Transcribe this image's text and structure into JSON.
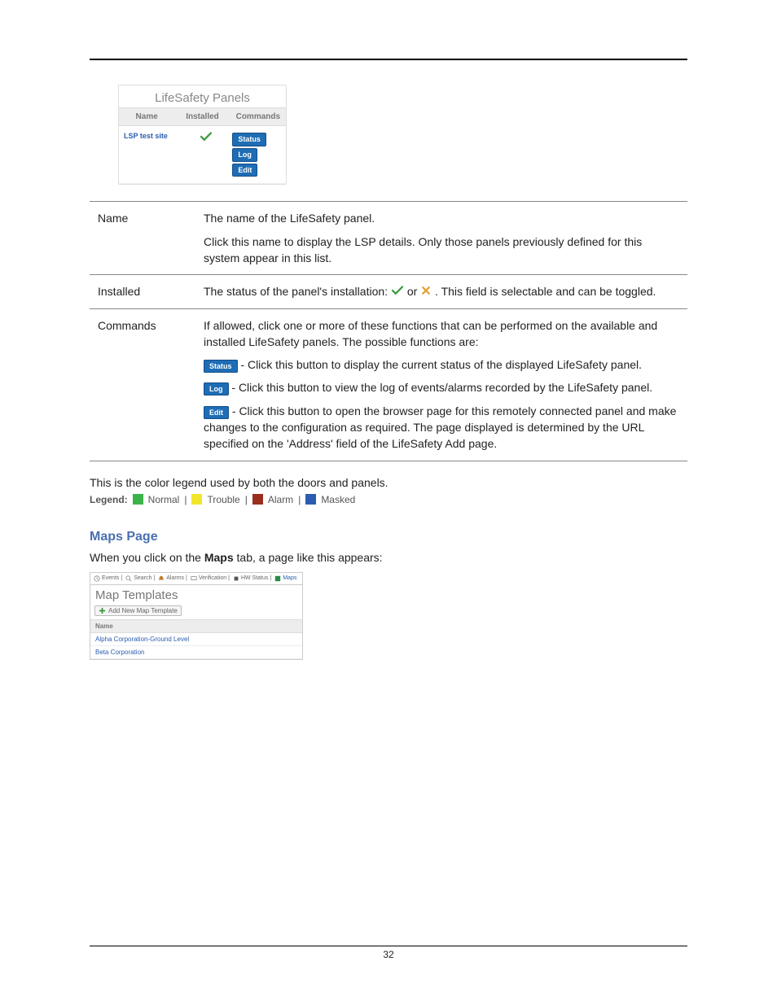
{
  "lsp": {
    "title": "LifeSafety Panels",
    "cols": [
      "Name",
      "Installed",
      "Commands"
    ],
    "row_name": "LSP test site",
    "btns": {
      "status": "Status",
      "log": "Log",
      "edit": "Edit"
    }
  },
  "desc": {
    "name_k": "Name",
    "name_v1": "The name of the LifeSafety panel.",
    "name_v2": "Click this name to display the LSP details. Only those panels previously defined for this system appear in this list.",
    "inst_k": "Installed",
    "inst_v1a": "The status of the panel's installation: ",
    "inst_v1b": " or ",
    "inst_v1c": ". This field is selectable and can be toggled.",
    "cmd_k": "Commands",
    "cmd_v1": "If allowed, click one or more of these functions that can be performed on the available and installed LifeSafety panels. The possible functions are:",
    "cmd_status": " - Click this button to display the current status of the displayed LifeSafety panel.",
    "cmd_log": " - Click this button to view the log of events/alarms recorded by the LifeSafety panel.",
    "cmd_edit": " - Click this button to open the browser page for this remotely connected panel and make changes to the configuration as required. The page displayed is determined by the URL specified on the 'Address' field of the LifeSafety Add page."
  },
  "legend_intro": "This is the color legend used by both the doors and panels.",
  "legend": {
    "label": "Legend:",
    "items": [
      {
        "name": "Normal",
        "color": "#3cb34a"
      },
      {
        "name": "Trouble",
        "color": "#f2e52c"
      },
      {
        "name": "Alarm",
        "color": "#9a2e1e"
      },
      {
        "name": "Masked",
        "color": "#2a5db0"
      }
    ]
  },
  "maps": {
    "heading": "Maps Page",
    "intro1": "When you click on the ",
    "intro_bold": "Maps",
    "intro2": " tab, a page like this appears:",
    "tabs": [
      "Events",
      "Search",
      "Alarms",
      "Verification",
      "HW Status",
      "Maps"
    ],
    "title": "Map Templates",
    "add": "Add New Map Template",
    "col": "Name",
    "rows": [
      "Alpha Corporation-Ground Level",
      "Beta Corporation"
    ]
  },
  "pagenum": "32"
}
